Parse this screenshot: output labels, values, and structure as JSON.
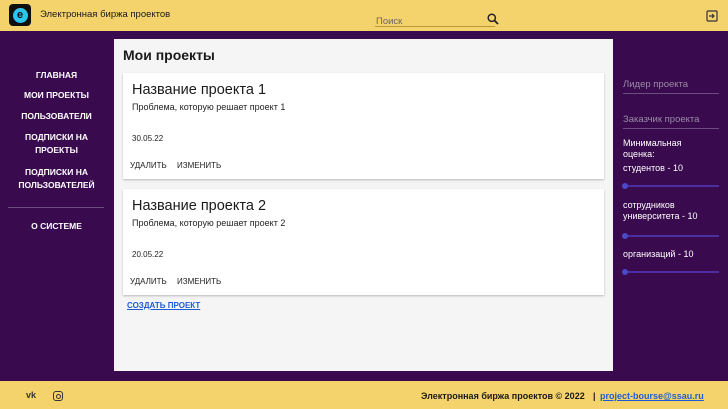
{
  "header": {
    "app_title": "Электронная биржа проектов",
    "search_placeholder": "Поиск",
    "icons": [
      "app-logo-icon",
      "search-icon",
      "logout-icon"
    ]
  },
  "nav": {
    "items": [
      {
        "label": "ГЛАВНАЯ"
      },
      {
        "label": "МОИ ПРОЕКТЫ"
      },
      {
        "label": "ПОЛЬЗОВАТЕЛИ"
      },
      {
        "label": "ПОДПИСКИ НА ПРОЕКТЫ"
      },
      {
        "label": "ПОДПИСКИ НА ПОЛЬЗОВАТЕЛЕЙ"
      },
      {
        "label": "О СИСТЕМЕ"
      }
    ]
  },
  "main": {
    "title": "Мои проекты",
    "projects": [
      {
        "name": "Название проекта 1",
        "description": "Проблема, которую решает проект 1",
        "date": "30.05.22",
        "delete_label": "УДАЛИТЬ",
        "edit_label": "ИЗМЕНИТЬ"
      },
      {
        "name": "Название проекта 2",
        "description": "Проблема, которую решает проект 2",
        "date": "20.05.22",
        "delete_label": "УДАЛИТЬ",
        "edit_label": "ИЗМЕНИТЬ"
      }
    ],
    "create_label": "СОЗДАТЬ ПРОЕКТ"
  },
  "filters": {
    "leader_placeholder": "Лидер проекта",
    "customer_placeholder": "Заказчик проекта",
    "rating_title_1": "Минимальная",
    "rating_title_2": "оценка:",
    "students": {
      "label": "студентов - 10",
      "value": 10
    },
    "staff": {
      "label_1": "сотрудников",
      "label_2": "университета - 10",
      "value": 10
    },
    "orgs": {
      "label": "организаций - 10",
      "value": 10
    }
  },
  "footer": {
    "copyright": "Электронная биржа проектов © 2022",
    "separator": "|",
    "email": "project-bourse@ssau.ru",
    "vk_label": "vk"
  },
  "colors": {
    "header_bg": "#f5d36c",
    "page_bg": "#3a0a4f",
    "link": "#1e5bd6",
    "slider": "#4a2fa3"
  }
}
